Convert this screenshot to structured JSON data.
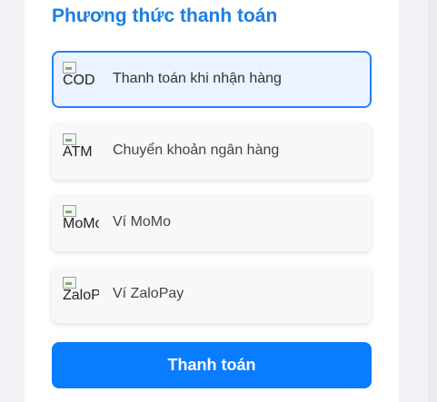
{
  "payment": {
    "title": "Phương thức thanh toán",
    "methods": [
      {
        "alt": "COD",
        "label": "Thanh toán khi nhận hàng",
        "selected": true,
        "icon": "cod-logo-broken-image"
      },
      {
        "alt": "ATM",
        "label": "Chuyển khoản ngân hàng",
        "selected": false,
        "icon": "atm-logo-broken-image"
      },
      {
        "alt": "MoMo",
        "label": "Ví MoMo",
        "selected": false,
        "icon": "momo-logo-broken-image"
      },
      {
        "alt": "ZaloPay",
        "label": "Ví ZaloPay",
        "selected": false,
        "icon": "zalopay-logo-broken-image"
      }
    ],
    "submit_label": "Thanh toán"
  },
  "colors": {
    "accent": "#1d7fe0",
    "button": "#0a7cff",
    "selected_border": "#2383f4",
    "selected_bg": "#eaf3ff"
  }
}
